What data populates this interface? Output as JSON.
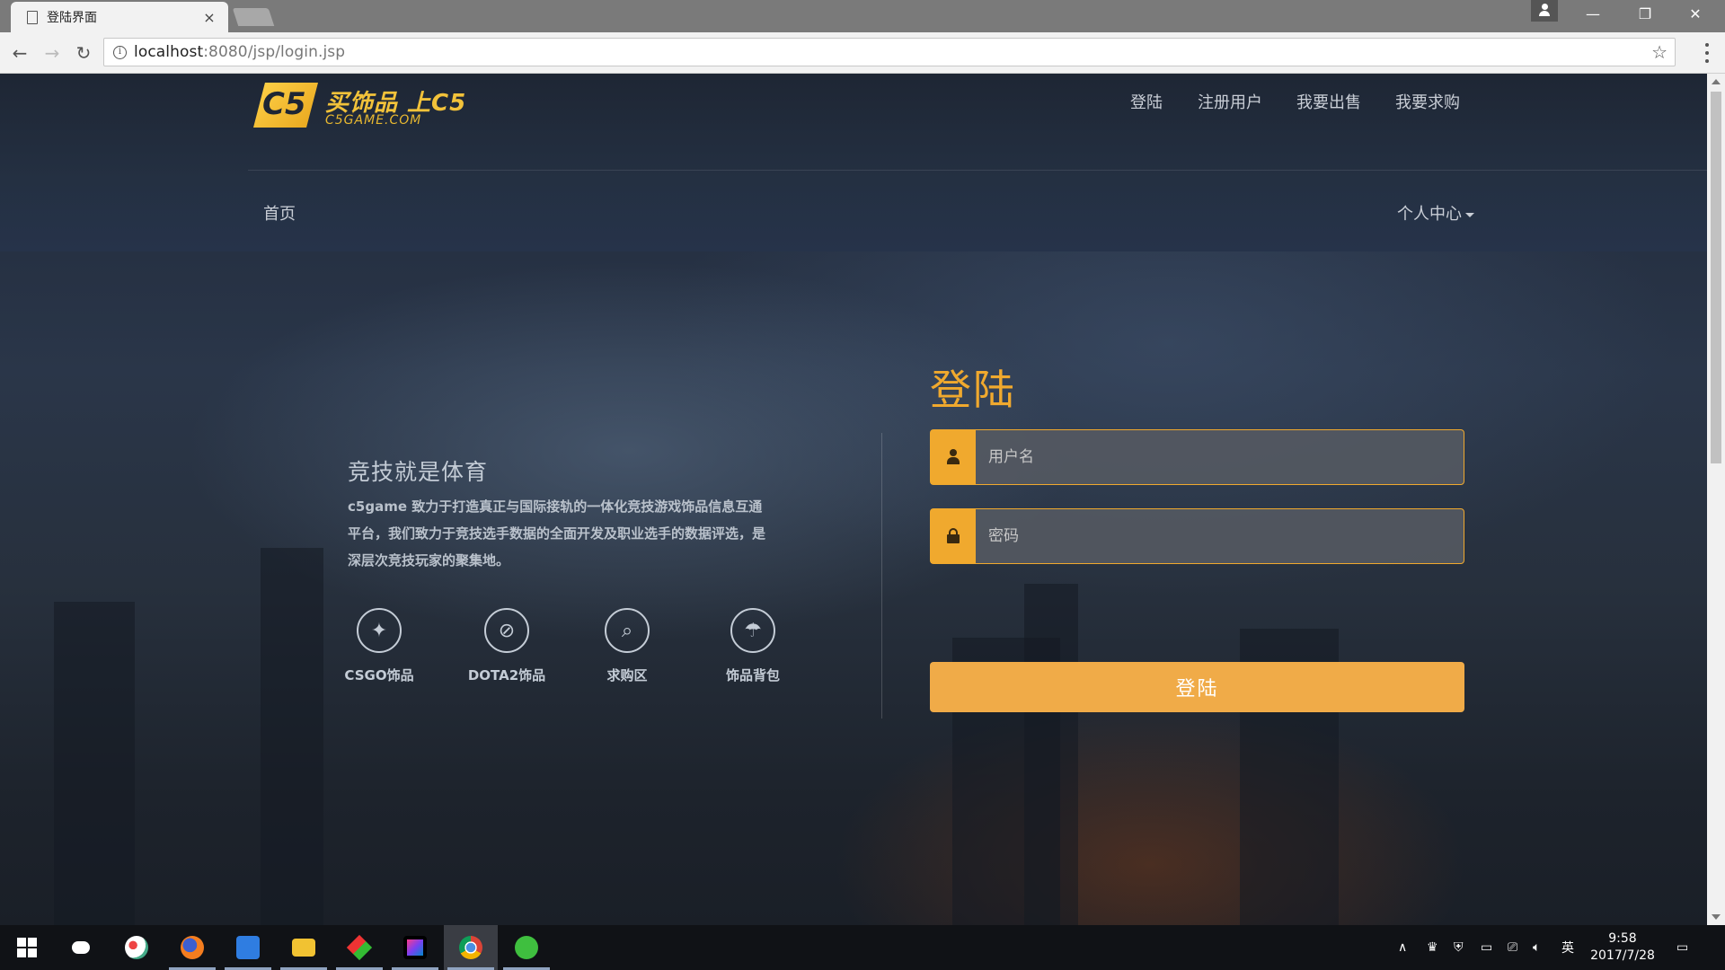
{
  "browser": {
    "tab_title": "登陆界面",
    "url_host": "localhost",
    "url_rest": ":8080/jsp/login.jsp"
  },
  "site": {
    "logo_mark": "C5",
    "logo_slogan": "买饰品 上C5",
    "logo_domain": "C5GAME.COM",
    "top_nav": [
      "登陆",
      "注册用户",
      "我要出售",
      "我要求购"
    ],
    "home": "首页",
    "personal_center": "个人中心"
  },
  "intro": {
    "title": "竞技就是体育",
    "text": "c5game 致力于打造真正与国际接轨的一体化竞技游戏饰品信息互通平台，我们致力于竞技选手数据的全面开发及职业选手的数据评选，是深层次竞技玩家的聚集地。",
    "features": [
      {
        "label": "CSGO饰品",
        "icon": "csgo-icon"
      },
      {
        "label": "DOTA2饰品",
        "icon": "dota2-icon"
      },
      {
        "label": "求购区",
        "icon": "purchase-icon"
      },
      {
        "label": "饰品背包",
        "icon": "backpack-icon"
      }
    ]
  },
  "login": {
    "title": "登陆",
    "username_placeholder": "用户名",
    "password_placeholder": "密码",
    "submit_label": "登陆",
    "accent_color": "#f0a92e"
  },
  "taskbar": {
    "time": "9:58",
    "date": "2017/7/28",
    "ime": "英",
    "apps": [
      "windows-start",
      "cortana",
      "paint",
      "firefox",
      "notes",
      "file-explorer",
      "git",
      "intellij",
      "chrome",
      "wechat"
    ]
  }
}
